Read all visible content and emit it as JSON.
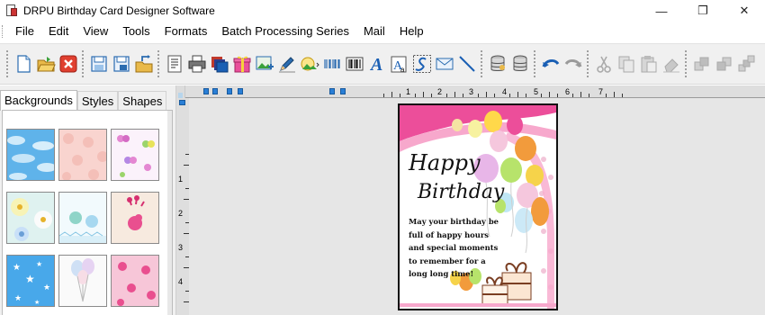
{
  "window": {
    "title": "DRPU Birthday Card Designer Software",
    "controls": {
      "minimize": "—",
      "maximize": "❐",
      "close": "✕"
    }
  },
  "menu": {
    "items": [
      "File",
      "Edit",
      "View",
      "Tools",
      "Formats",
      "Batch Processing Series",
      "Mail",
      "Help"
    ]
  },
  "toolbar": {
    "groups": [
      [
        "new-icon",
        "open-icon",
        "close-file-icon"
      ],
      [
        "save-icon",
        "save-as-icon",
        "export-icon"
      ],
      [
        "properties-icon",
        "print-icon",
        "print-preview-icon",
        "gift-icon",
        "insert-image-icon",
        "pen-icon",
        "picture-icon",
        "linear-barcode-icon",
        "barcode-icon",
        "text-icon",
        "word-art-icon",
        "signature-icon",
        "mail-icon",
        "line-icon"
      ],
      [
        "database-icon",
        "database-settings-icon"
      ],
      [
        "undo-icon",
        "redo-icon"
      ],
      [
        "cut-icon",
        "copy-icon",
        "paste-icon",
        "delete-icon"
      ],
      [
        "bring-forward-icon",
        "send-backward-icon",
        "bring-to-front-icon"
      ]
    ]
  },
  "left_panel": {
    "tabs": [
      "Backgrounds",
      "Styles",
      "Shapes"
    ],
    "active_tab": "Backgrounds",
    "thumbnails": [
      "sky-clouds",
      "pink-pattern",
      "butterflies",
      "flowers",
      "teddy-bears",
      "bird-pink",
      "stars-blue",
      "balloons",
      "cupcakes-pink"
    ]
  },
  "ruler": {
    "horizontal_labels": [
      "1",
      "2",
      "3",
      "4",
      "5",
      "6",
      "7"
    ],
    "vertical_labels": [
      "1",
      "2",
      "3",
      "4"
    ]
  },
  "card": {
    "title_line1": "Happy",
    "title_line2": "Birthday",
    "message": "May your birthday be full of happy hours and special moments to remember for a long long time!"
  },
  "colors": {
    "accent_blue": "#2a7fd6",
    "toolbar_bg": "#f0f0f0",
    "canvas_bg": "#e6e6e6"
  }
}
